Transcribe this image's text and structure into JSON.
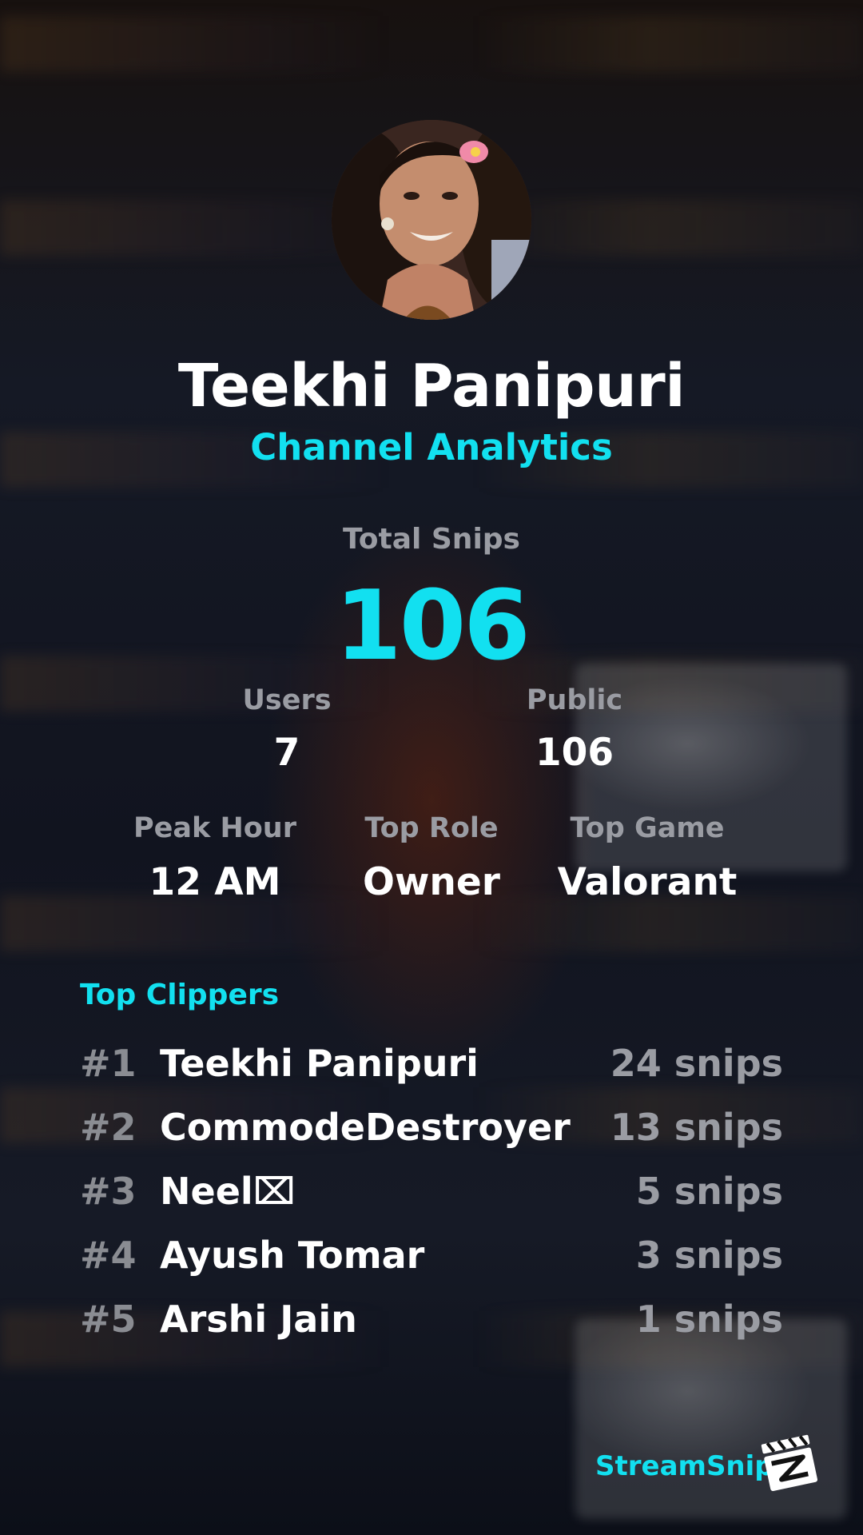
{
  "profile": {
    "name": "Teekhi Panipuri",
    "subtitle": "Channel Analytics"
  },
  "totals": {
    "label": "Total Snips",
    "value": "106"
  },
  "stats": {
    "users": {
      "label": "Users",
      "value": "7"
    },
    "public": {
      "label": "Public",
      "value": "106"
    },
    "peak_hour": {
      "label": "Peak Hour",
      "value": "12 AM"
    },
    "top_role": {
      "label": "Top Role",
      "value": "Owner"
    },
    "top_game": {
      "label": "Top Game",
      "value": "Valorant"
    }
  },
  "top_clippers": {
    "title": "Top Clippers",
    "items": [
      {
        "rank": "#1",
        "name": "Teekhi Panipuri",
        "count": "24 snips"
      },
      {
        "rank": "#2",
        "name": "CommodeDestroyer",
        "count": "13 snips"
      },
      {
        "rank": "#3",
        "name": "Neel⌧",
        "count": "5 snips"
      },
      {
        "rank": "#4",
        "name": "Ayush Tomar",
        "count": "3 snips"
      },
      {
        "rank": "#5",
        "name": "Arshi Jain",
        "count": "1 snips"
      }
    ]
  },
  "branding": {
    "label": "StreamSnip",
    "icon": "clapperboard-icon"
  },
  "colors": {
    "accent": "#12e0f0",
    "muted": "#9a9ca3",
    "text": "#ffffff"
  }
}
